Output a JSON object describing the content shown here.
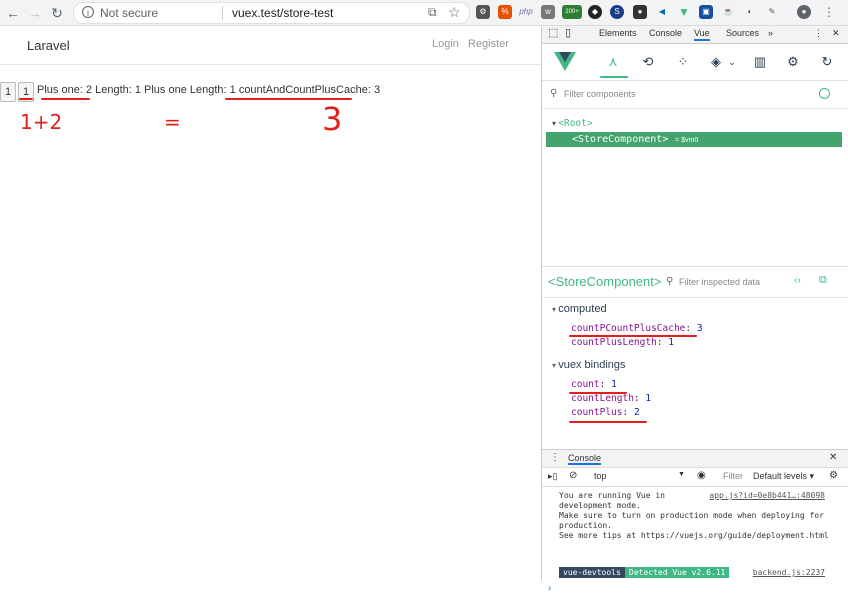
{
  "browser": {
    "security_label": "Not secure",
    "url": "vuex.test/store-test",
    "extension_badge": "200+"
  },
  "navbar": {
    "brand": "Laravel",
    "login": "Login",
    "register": "Register"
  },
  "content": {
    "button1": "1",
    "button2": "1",
    "line": "Plus one: 2 Length: 1 Plus one Length: 1 countAndCountPlusCache: 3"
  },
  "annotations": {
    "left": "1+2",
    "middle": "=",
    "right": "3"
  },
  "devtools": {
    "tabs": [
      "Elements",
      "Console",
      "Vue",
      "Sources"
    ],
    "more": "»",
    "filter_components_placeholder": "Filter components",
    "tree": {
      "root": "<Root>",
      "selected": "<StoreComponent>",
      "selected_suffix": "= $vm0"
    },
    "inspector": {
      "component": "<StoreComponent>",
      "filter_placeholder": "Filter inspected data"
    },
    "computed_title": "computed",
    "computed": [
      {
        "key": "countPCountPlusCache",
        "value": "3"
      },
      {
        "key": "countPlusLength",
        "value": "1"
      }
    ],
    "vuex_title": "vuex bindings",
    "vuex": [
      {
        "key": "count",
        "value": "1"
      },
      {
        "key": "countLength",
        "value": "1"
      },
      {
        "key": "countPlus",
        "value": "2"
      }
    ]
  },
  "console": {
    "tab": "Console",
    "context": "top",
    "filter": "Filter",
    "levels": "Default levels ▾",
    "message_lines": [
      "You are running Vue in",
      "development mode.",
      "Make sure to turn on production mode when deploying for",
      "production.",
      "See more tips at https://vuejs.org/guide/deployment.html"
    ],
    "source1": "app.js?id=0e8b441…:48098",
    "badge_left": "vue-devtools",
    "badge_right": "Detected Vue v2.6.11",
    "source2": "backend.js:2237",
    "prompt": "›"
  }
}
